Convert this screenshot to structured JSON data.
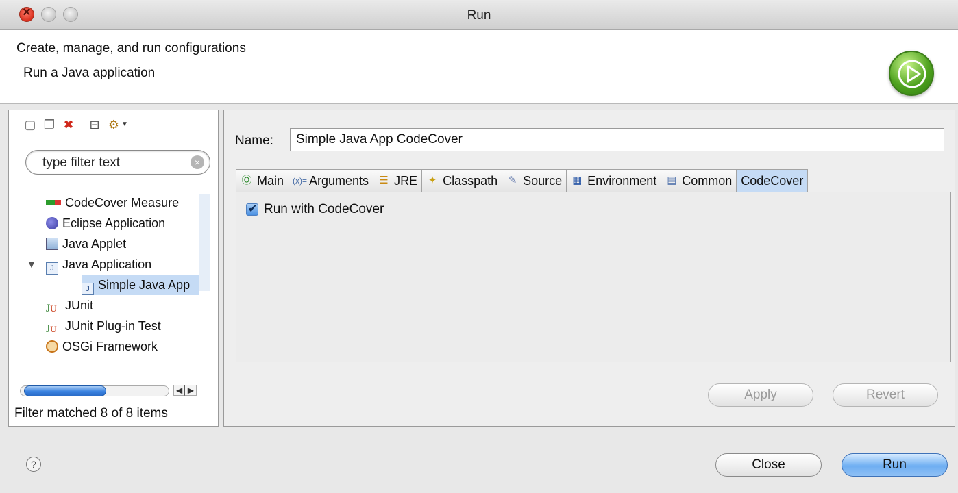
{
  "window": {
    "title": "Run"
  },
  "header": {
    "title": "Create, manage, and run configurations",
    "subtitle": "Run a Java application",
    "badge_icon": "run-play-icon"
  },
  "left": {
    "toolbar": [
      {
        "name": "new-configuration-icon",
        "glyph": "🗋"
      },
      {
        "name": "duplicate-configuration-icon",
        "glyph": "❐"
      },
      {
        "name": "delete-configuration-icon",
        "glyph": "✖"
      },
      {
        "name": "collapse-all-icon",
        "glyph": "⊟"
      },
      {
        "name": "filter-configurations-icon",
        "glyph": "⚙"
      }
    ],
    "filter_placeholder": "type filter text",
    "tree": [
      {
        "label": "CodeCover Measure",
        "icon": "codecover-icon",
        "level": 0
      },
      {
        "label": "Eclipse Application",
        "icon": "eclipse-icon",
        "level": 0
      },
      {
        "label": "Java Applet",
        "icon": "java-applet-icon",
        "level": 0
      },
      {
        "label": "Java Application",
        "icon": "java-application-icon",
        "level": 0,
        "expanded": true
      },
      {
        "label": "Simple Java App",
        "icon": "java-application-icon",
        "level": 1,
        "selected": true
      },
      {
        "label": "JUnit",
        "icon": "junit-icon",
        "level": 0
      },
      {
        "label": "JUnit Plug-in Test",
        "icon": "junit-plugin-icon",
        "level": 0
      },
      {
        "label": "OSGi Framework",
        "icon": "osgi-icon",
        "level": 0
      }
    ],
    "status": "Filter matched 8 of 8 items"
  },
  "right": {
    "name_label": "Name:",
    "name_value": "Simple Java App CodeCover",
    "tabs": [
      {
        "label": "Main",
        "icon": "main-tab-icon",
        "glyph": "Ⓖ"
      },
      {
        "label": "Arguments",
        "icon": "arguments-tab-icon",
        "glyph": "ⓧ"
      },
      {
        "label": "JRE",
        "icon": "jre-tab-icon",
        "glyph": "≡"
      },
      {
        "label": "Classpath",
        "icon": "classpath-tab-icon",
        "glyph": "✦"
      },
      {
        "label": "Source",
        "icon": "source-tab-icon",
        "glyph": "✎"
      },
      {
        "label": "Environment",
        "icon": "environment-tab-icon",
        "glyph": "▦"
      },
      {
        "label": "Common",
        "icon": "common-tab-icon",
        "glyph": "▤"
      },
      {
        "label": "CodeCover",
        "icon": "",
        "glyph": "",
        "active": true
      }
    ],
    "checkbox_label": "Run with CodeCover",
    "checkbox_checked": true,
    "apply_label": "Apply",
    "revert_label": "Revert"
  },
  "footer": {
    "help_glyph": "?",
    "close_label": "Close",
    "run_label": "Run"
  }
}
